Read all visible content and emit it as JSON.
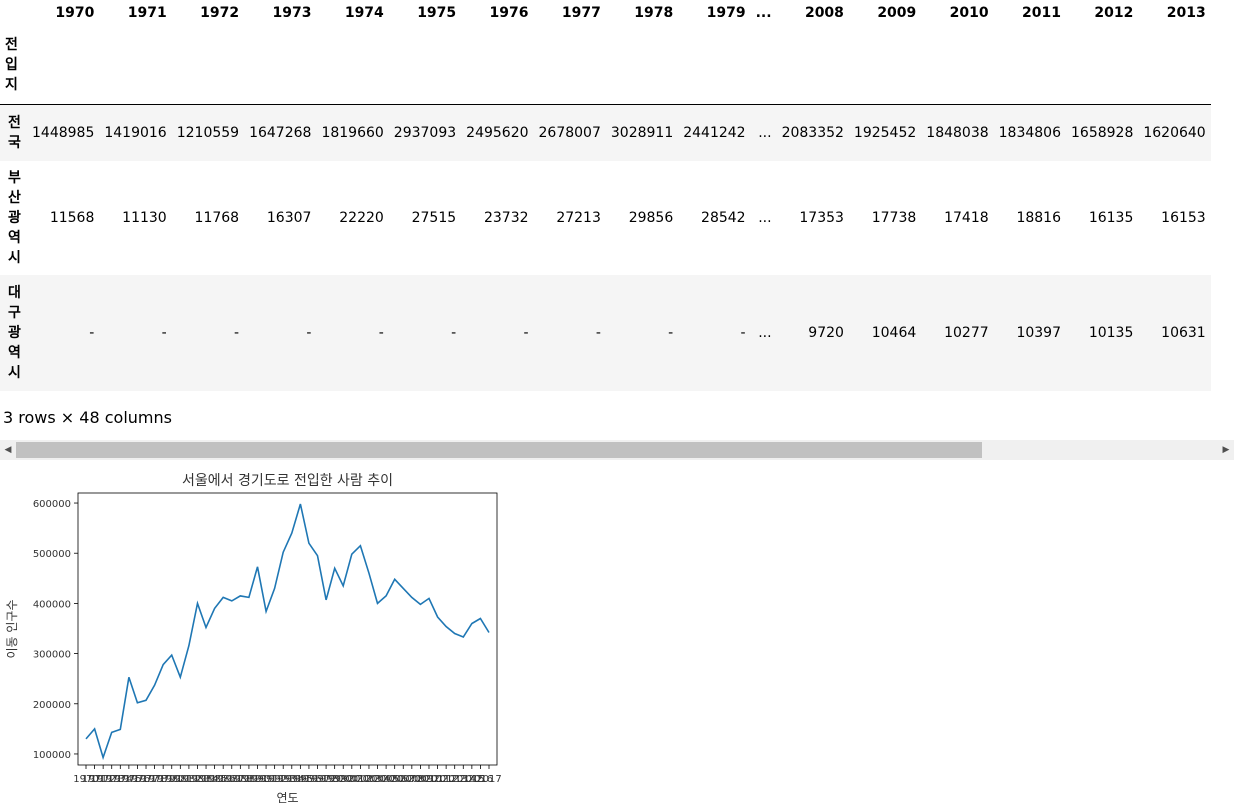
{
  "table": {
    "columns": [
      "1970",
      "1971",
      "1972",
      "1973",
      "1974",
      "1975",
      "1976",
      "1977",
      "1978",
      "1979",
      "...",
      "2008",
      "2009",
      "2010",
      "2011",
      "2012",
      "2013"
    ],
    "index_name": "전입지",
    "rows": [
      {
        "label": "전국",
        "values": [
          "1448985",
          "1419016",
          "1210559",
          "1647268",
          "1819660",
          "2937093",
          "2495620",
          "2678007",
          "3028911",
          "2441242",
          "...",
          "2083352",
          "1925452",
          "1848038",
          "1834806",
          "1658928",
          "1620640"
        ]
      },
      {
        "label": "부산광역시",
        "values": [
          "11568",
          "11130",
          "11768",
          "16307",
          "22220",
          "27515",
          "23732",
          "27213",
          "29856",
          "28542",
          "...",
          "17353",
          "17738",
          "17418",
          "18816",
          "16135",
          "16153"
        ]
      },
      {
        "label": "대구광역시",
        "values": [
          "-",
          "-",
          "-",
          "-",
          "-",
          "-",
          "-",
          "-",
          "-",
          "-",
          "...",
          "9720",
          "10464",
          "10277",
          "10397",
          "10135",
          "10631"
        ]
      }
    ]
  },
  "shape_text": "3 rows × 48 columns",
  "scroll": {
    "left_arrow": "◀",
    "right_arrow": "▶"
  },
  "chart_data": {
    "type": "line",
    "title": "서울에서 경기도로 전입한 사람 추이",
    "xlabel": "연도",
    "ylabel": "이동 인구수",
    "x": [
      "1970",
      "1971",
      "1972",
      "1973",
      "1974",
      "1975",
      "1976",
      "1977",
      "1978",
      "1979",
      "1980",
      "1981",
      "1982",
      "1983",
      "1984",
      "1985",
      "1986",
      "1987",
      "1988",
      "1989",
      "1990",
      "1991",
      "1992",
      "1993",
      "1994",
      "1995",
      "1996",
      "1997",
      "1998",
      "1999",
      "2000",
      "2001",
      "2002",
      "2003",
      "2004",
      "2005",
      "2006",
      "2007",
      "2008",
      "2009",
      "2010",
      "2011",
      "2012",
      "2013",
      "2014",
      "2015",
      "2016",
      "2017"
    ],
    "values": [
      130000,
      150000,
      93000,
      143000,
      149000,
      253000,
      202000,
      207000,
      237000,
      278000,
      297000,
      253000,
      316000,
      400000,
      352000,
      390000,
      412000,
      405000,
      415000,
      412000,
      473000,
      384000,
      430000,
      502000,
      540000,
      598000,
      520000,
      495000,
      407000,
      470000,
      435000,
      498000,
      515000,
      460000,
      400000,
      415000,
      448000,
      430000,
      412000,
      398000,
      410000,
      373000,
      354000,
      340000,
      333000,
      360000,
      370000,
      342000
    ],
    "yticks": [
      100000,
      200000,
      300000,
      400000,
      500000,
      600000
    ],
    "ylim": [
      78000,
      620000
    ],
    "grid": false,
    "color": "#1f77b4"
  }
}
